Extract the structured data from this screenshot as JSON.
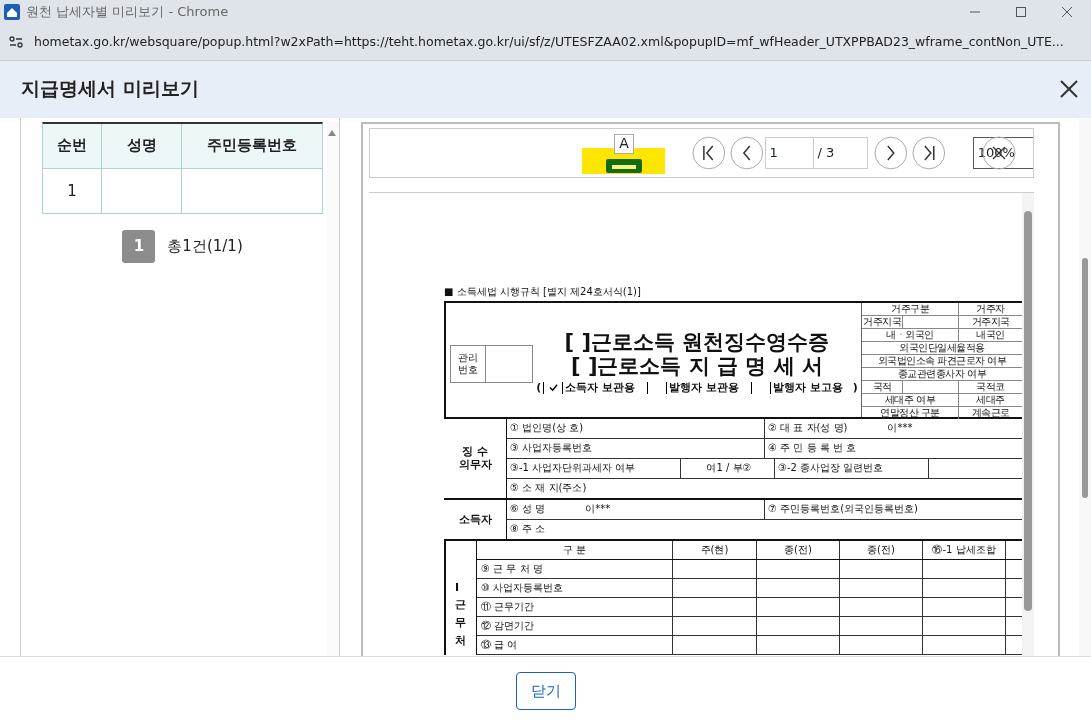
{
  "window": {
    "title": "원천 납세자별 미리보기 - Chrome"
  },
  "address_bar": {
    "url": "hometax.go.kr/websquare/popup.html?w2xPath=https://teht.hometax.go.kr/ui/sf/z/UTESFZAA02.xml&popupID=mf_wfHeader_UTXPPBAD23_wframe_contNon_UTE..."
  },
  "dialog": {
    "title": "지급명세서 미리보기"
  },
  "list": {
    "columns": [
      "순번",
      "성명",
      "주민등록번호"
    ],
    "rows": [
      {
        "number": "1"
      }
    ]
  },
  "pagination": {
    "pages": [
      {
        "label": "1",
        "selected": true
      }
    ],
    "summary": "총1건(1/1)"
  },
  "viewer": {
    "print_label": "A",
    "page": "1",
    "page_total": "/ 3",
    "zoom": "100%"
  },
  "form": {
    "regulation": "■ 소득세법 시행규칙 [별지 제24호서식(1)]",
    "management_label": "관리 번호",
    "title_lines": [
      "[ ]근로소득 원천징수영수증",
      "[ ]근로소득 지 급 명 세 서"
    ],
    "copies_open": "(",
    "copies_close": ")",
    "copies": [
      {
        "label": "소득자 보관용",
        "checked": true
      },
      {
        "label": "발행자 보관용",
        "checked": false
      },
      {
        "label": "발행자 보고용",
        "checked": false
      }
    ],
    "side_rows": [
      {
        "kind": "pair",
        "label": "거주구분",
        "value": "거주자"
      },
      {
        "kind": "split",
        "label": "거주지국",
        "value": "거주지국"
      },
      {
        "kind": "pair",
        "label": "내ㆍ외국인",
        "value": "내국인"
      },
      {
        "kind": "wide",
        "label": "외국인단일세율적용"
      },
      {
        "kind": "wide",
        "label": "외국법인소속 파견근로자 여부"
      },
      {
        "kind": "wide",
        "label": "종교관련종사자 여부"
      },
      {
        "kind": "split",
        "label": "국적",
        "value": "국적코"
      },
      {
        "kind": "pair",
        "label": "세대주 여부",
        "value": "세대주"
      },
      {
        "kind": "pair",
        "label": "연말정산 구분",
        "value": "계속근로"
      }
    ],
    "withholder": {
      "label": "징 수 의무자",
      "rows": [
        {
          "kind": "two",
          "left": "① 법인명(상 호)",
          "right": "② 대 표 자(성 명)",
          "right_value": "이***"
        },
        {
          "kind": "two",
          "left": "③ 사업자등록번호",
          "right": "④ 주 민 등 록 번 호"
        },
        {
          "kind": "split",
          "left": "③-1 사업자단위과세자 여부",
          "left_value": "여1 / 부②",
          "right": "③-2 종사업장 일련번호"
        },
        {
          "kind": "one",
          "left": "⑤ 소 재 지(주소)"
        }
      ]
    },
    "earner": {
      "label": "소득자",
      "rows": [
        {
          "kind": "two",
          "left": "⑥ 성 명",
          "left_value": "이***",
          "right": "⑦ 주민등록번호(외국인등록번호)"
        },
        {
          "kind": "one",
          "left": "⑧ 주 소"
        }
      ]
    },
    "workplace": {
      "label": "I근무처",
      "columns": [
        "구 분",
        "주(현)",
        "종(전)",
        "종(전)",
        "⑯-1 납세조합"
      ],
      "rows": [
        "⑨ 근 무 처 명",
        "⑩ 사업자등록번호",
        "⑪ 근무기간",
        "⑫ 감면기간",
        "⑬ 급 여"
      ]
    }
  },
  "footer": {
    "close_button": "닫기"
  }
}
